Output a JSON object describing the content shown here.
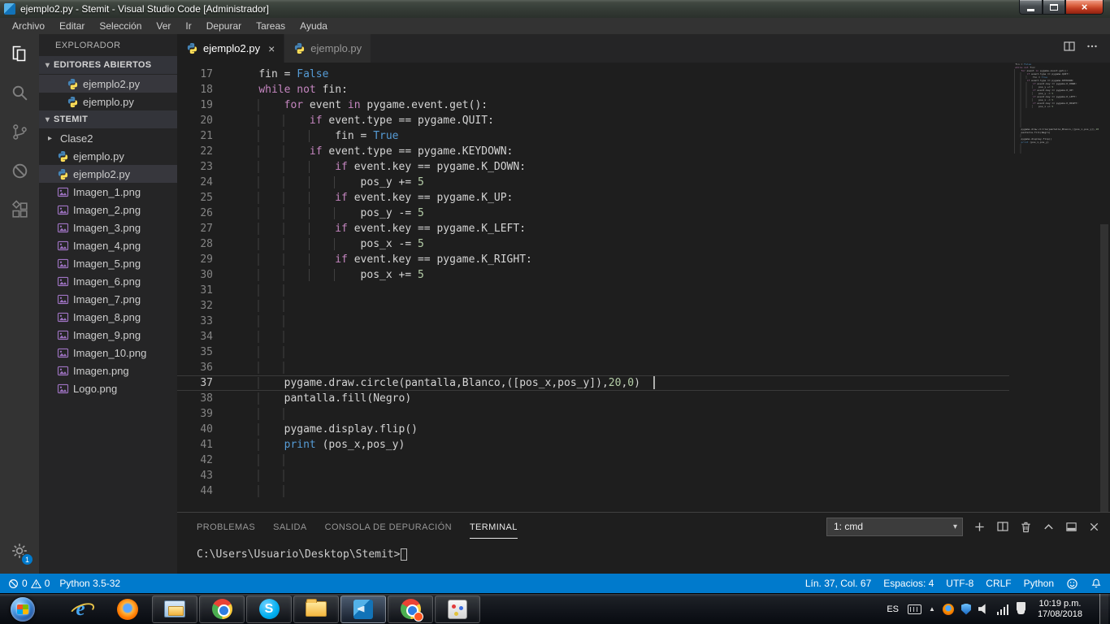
{
  "window": {
    "title": "ejemplo2.py - Stemit - Visual Studio Code [Administrador]",
    "controls": {
      "close": "×"
    }
  },
  "menu": {
    "items": [
      "Archivo",
      "Editar",
      "Selección",
      "Ver",
      "Ir",
      "Depurar",
      "Tareas",
      "Ayuda"
    ]
  },
  "activity_bar": {
    "items": [
      {
        "name": "explorer",
        "icon": "files",
        "active": true
      },
      {
        "name": "search",
        "icon": "search"
      },
      {
        "name": "source-control",
        "icon": "git"
      },
      {
        "name": "debug",
        "icon": "debug"
      },
      {
        "name": "extensions",
        "icon": "extensions"
      }
    ],
    "settings_badge": "1"
  },
  "sidebar": {
    "title": "EXPLORADOR",
    "chevron_expanded": "▾",
    "chevron_collapsed": "▸",
    "sections": [
      {
        "label": "EDITORES ABIERTOS",
        "indent": 34,
        "items": [
          {
            "name": "ejemplo2.py",
            "icon": "python",
            "state": "active"
          },
          {
            "name": "ejemplo.py",
            "icon": "python"
          }
        ]
      },
      {
        "label": "STEMIT",
        "indent": 22,
        "items": [
          {
            "name": "Clase2",
            "icon": "folder"
          },
          {
            "name": "ejemplo.py",
            "icon": "python"
          },
          {
            "name": "ejemplo2.py",
            "icon": "python",
            "state": "selected"
          },
          {
            "name": "Imagen_1.png",
            "icon": "image"
          },
          {
            "name": "Imagen_2.png",
            "icon": "image"
          },
          {
            "name": "Imagen_3.png",
            "icon": "image"
          },
          {
            "name": "Imagen_4.png",
            "icon": "image"
          },
          {
            "name": "Imagen_5.png",
            "icon": "image"
          },
          {
            "name": "Imagen_6.png",
            "icon": "image"
          },
          {
            "name": "Imagen_7.png",
            "icon": "image"
          },
          {
            "name": "Imagen_8.png",
            "icon": "image"
          },
          {
            "name": "Imagen_9.png",
            "icon": "image"
          },
          {
            "name": "Imagen_10.png",
            "icon": "image"
          },
          {
            "name": "Imagen.png",
            "icon": "image"
          },
          {
            "name": "Logo.png",
            "icon": "image"
          }
        ]
      }
    ]
  },
  "tabs": [
    {
      "label": "ejemplo2.py",
      "active": true,
      "close": "×"
    },
    {
      "label": "ejemplo.py",
      "active": false
    }
  ],
  "editor_actions": [
    {
      "name": "split-editor",
      "icon": "split-editor"
    },
    {
      "name": "more-actions",
      "icon": "more"
    }
  ],
  "editor": {
    "lines": [
      {
        "num": 17,
        "tokens": [
          [
            "ws",
            "    "
          ],
          [
            "d",
            "fin = "
          ],
          [
            "b",
            "False"
          ]
        ]
      },
      {
        "num": 18,
        "tokens": [
          [
            "ws",
            "    "
          ],
          [
            "k",
            "while"
          ],
          [
            "d",
            " "
          ],
          [
            "k",
            "not"
          ],
          [
            "d",
            " fin:"
          ]
        ]
      },
      {
        "num": 19,
        "tokens": [
          [
            "ws",
            "        "
          ],
          [
            "k",
            "for"
          ],
          [
            "d",
            " event "
          ],
          [
            "k",
            "in"
          ],
          [
            "d",
            " pygame.event.get():"
          ]
        ]
      },
      {
        "num": 20,
        "tokens": [
          [
            "ws",
            "            "
          ],
          [
            "k",
            "if"
          ],
          [
            "d",
            " event.type == pygame.QUIT:"
          ]
        ]
      },
      {
        "num": 21,
        "tokens": [
          [
            "ws",
            "                "
          ],
          [
            "d",
            "fin = "
          ],
          [
            "b",
            "True"
          ]
        ]
      },
      {
        "num": 22,
        "tokens": [
          [
            "ws",
            "            "
          ],
          [
            "k",
            "if"
          ],
          [
            "d",
            " event.type == pygame.KEYDOWN:"
          ]
        ]
      },
      {
        "num": 23,
        "tokens": [
          [
            "ws",
            "                "
          ],
          [
            "k",
            "if"
          ],
          [
            "d",
            " event.key == pygame.K_DOWN:"
          ]
        ]
      },
      {
        "num": 24,
        "tokens": [
          [
            "ws",
            "                    "
          ],
          [
            "d",
            "pos_y += "
          ],
          [
            "n",
            "5"
          ]
        ]
      },
      {
        "num": 25,
        "tokens": [
          [
            "ws",
            "                "
          ],
          [
            "k",
            "if"
          ],
          [
            "d",
            " event.key == pygame.K_UP:"
          ]
        ]
      },
      {
        "num": 26,
        "tokens": [
          [
            "ws",
            "                    "
          ],
          [
            "d",
            "pos_y -= "
          ],
          [
            "n",
            "5"
          ]
        ]
      },
      {
        "num": 27,
        "tokens": [
          [
            "ws",
            "                "
          ],
          [
            "k",
            "if"
          ],
          [
            "d",
            " event.key == pygame.K_LEFT:"
          ]
        ]
      },
      {
        "num": 28,
        "tokens": [
          [
            "ws",
            "                    "
          ],
          [
            "d",
            "pos_x -= "
          ],
          [
            "n",
            "5"
          ]
        ]
      },
      {
        "num": 29,
        "tokens": [
          [
            "ws",
            "                "
          ],
          [
            "k",
            "if"
          ],
          [
            "d",
            " event.key == pygame.K_RIGHT:"
          ]
        ]
      },
      {
        "num": 30,
        "tokens": [
          [
            "ws",
            "                    "
          ],
          [
            "d",
            "pos_x += "
          ],
          [
            "n",
            "5"
          ]
        ]
      },
      {
        "num": 31,
        "tokens": [
          [
            "ws",
            "            "
          ]
        ]
      },
      {
        "num": 32,
        "tokens": [
          [
            "ws",
            "            "
          ]
        ]
      },
      {
        "num": 33,
        "tokens": [
          [
            "ws",
            "            "
          ]
        ]
      },
      {
        "num": 34,
        "tokens": [
          [
            "ws",
            "            "
          ]
        ]
      },
      {
        "num": 35,
        "tokens": [
          [
            "ws",
            "            "
          ]
        ]
      },
      {
        "num": 36,
        "tokens": [
          [
            "ws",
            "            "
          ]
        ]
      },
      {
        "num": 37,
        "active": true,
        "cursor": true,
        "tokens": [
          [
            "ws",
            "        "
          ],
          [
            "d",
            "pygame.draw.circle(pantalla,Blanco,([pos_x,pos_y]),"
          ],
          [
            "n",
            "20"
          ],
          [
            "d",
            ","
          ],
          [
            "n",
            "0"
          ],
          [
            "d",
            ")  "
          ]
        ]
      },
      {
        "num": 38,
        "tokens": [
          [
            "ws",
            "        "
          ],
          [
            "d",
            "pantalla.fill(Negro)"
          ]
        ]
      },
      {
        "num": 39,
        "tokens": [
          [
            "ws",
            "            "
          ]
        ]
      },
      {
        "num": 40,
        "tokens": [
          [
            "ws",
            "        "
          ],
          [
            "d",
            "pygame.display.flip()"
          ]
        ]
      },
      {
        "num": 41,
        "tokens": [
          [
            "ws",
            "        "
          ],
          [
            "b",
            "print"
          ],
          [
            "d",
            " (pos_x,pos_y)"
          ]
        ]
      },
      {
        "num": 42,
        "tokens": [
          [
            "ws",
            "            "
          ]
        ]
      },
      {
        "num": 43,
        "tokens": [
          [
            "ws",
            "            "
          ]
        ]
      },
      {
        "num": 44,
        "tokens": [
          [
            "ws",
            "            "
          ]
        ]
      }
    ]
  },
  "panel": {
    "tabs": [
      {
        "label": "PROBLEMAS"
      },
      {
        "label": "SALIDA"
      },
      {
        "label": "CONSOLA DE DEPURACIÓN"
      },
      {
        "label": "TERMINAL",
        "active": true
      }
    ],
    "terminal_select": "1: cmd",
    "select_caret": "▾",
    "actions": [
      {
        "name": "new-terminal",
        "icon": "plus"
      },
      {
        "name": "split-terminal",
        "icon": "split-editor"
      },
      {
        "name": "kill-terminal",
        "icon": "trash"
      },
      {
        "name": "maximize-panel",
        "icon": "chevron-up"
      },
      {
        "name": "panel-layout",
        "icon": "panel"
      },
      {
        "name": "close-panel",
        "icon": "close"
      }
    ],
    "prompt": "C:\\Users\\Usuario\\Desktop\\Stemit>"
  },
  "status_bar": {
    "errors": "0",
    "warnings": "0",
    "inter": "Python 3.5-32",
    "right_items": [
      "Lín. 37, Col. 67",
      "Espacios: 4",
      "UTF-8",
      "CRLF",
      "Python"
    ],
    "icons": [
      {
        "name": "feedback",
        "icon": "smiley"
      },
      {
        "name": "notifications",
        "icon": "bell"
      }
    ]
  },
  "taskbar": {
    "apps": [
      {
        "name": "internet-explorer"
      },
      {
        "name": "firefox"
      },
      {
        "name": "libraries",
        "open": true
      },
      {
        "name": "chrome",
        "open": true
      },
      {
        "name": "skype",
        "open": true
      },
      {
        "name": "file-explorer",
        "open": true
      },
      {
        "name": "vscode",
        "open": true,
        "active": true
      },
      {
        "name": "chrome-secondary",
        "open": true
      },
      {
        "name": "paint",
        "open": true
      }
    ],
    "tray": {
      "language": "ES",
      "expand_char": "▲",
      "icons": [
        "keyboard",
        "tray-expand",
        "firefox-tray",
        "shield-tray",
        "volume",
        "network",
        "power"
      ],
      "time": "10:19 p.m.",
      "date": "17/08/2018"
    }
  },
  "colors": {
    "accent": "#007acc",
    "keyword": "#c586c0",
    "constant": "#569cd6",
    "number": "#b5cea8",
    "text": "#d4d4d4",
    "editor_bg": "#1e1e1e"
  }
}
